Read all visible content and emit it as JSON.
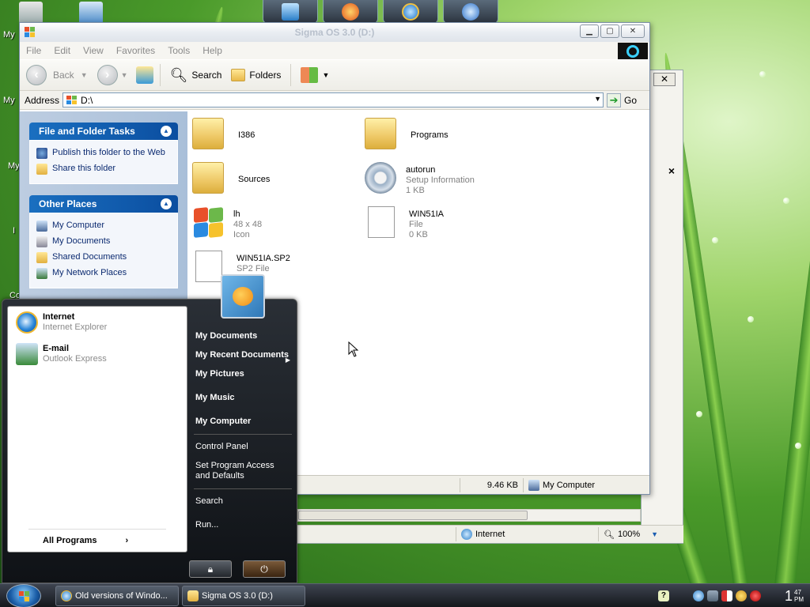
{
  "desktop": {
    "icon_labels": [
      "My",
      "My",
      "My",
      "I",
      "Co"
    ]
  },
  "explorer": {
    "title": "Sigma OS 3.0 (D:)",
    "menu": [
      "File",
      "Edit",
      "View",
      "Favorites",
      "Tools",
      "Help"
    ],
    "toolbar": {
      "back": "Back",
      "search": "Search",
      "folders": "Folders"
    },
    "address": {
      "label": "Address",
      "value": "D:\\",
      "go": "Go"
    },
    "tasks_panel": {
      "title": "File and Folder Tasks",
      "items": [
        "Publish this folder to the Web",
        "Share this folder"
      ]
    },
    "places_panel": {
      "title": "Other Places",
      "items": [
        "My Computer",
        "My Documents",
        "Shared Documents",
        "My Network Places"
      ]
    },
    "files": [
      {
        "name": "I386",
        "line2": "",
        "line3": "",
        "icon": "folder-icon"
      },
      {
        "name": "Programs",
        "line2": "",
        "line3": "",
        "icon": "folder-icon"
      },
      {
        "name": "Sources",
        "line2": "",
        "line3": "",
        "icon": "folder-icon"
      },
      {
        "name": "autorun",
        "line2": "Setup Information",
        "line3": "1 KB",
        "icon": "settings-file-icon"
      },
      {
        "name": "lh",
        "line2": "48 x 48",
        "line3": "Icon",
        "icon": "windows-logo-icon"
      },
      {
        "name": "WIN51IA",
        "line2": "File",
        "line3": "0 KB",
        "icon": "file-icon"
      },
      {
        "name": "WIN51IA.SP2",
        "line2": "SP2 File",
        "line3": "",
        "icon": "file-icon"
      }
    ],
    "status": {
      "size": "9.46 KB",
      "location": "My Computer"
    }
  },
  "ie_window": {
    "close": "✕",
    "status_zone": "Internet",
    "zoom": "100%"
  },
  "start_menu": {
    "pinned": [
      {
        "title": "Internet",
        "subtitle": "Internet Explorer"
      },
      {
        "title": "E-mail",
        "subtitle": "Outlook Express"
      }
    ],
    "all_programs": "All Programs",
    "right_items": [
      {
        "label": "My Documents",
        "bold": true
      },
      {
        "label": "My Recent Documents",
        "bold": true
      },
      {
        "label": "My Pictures",
        "bold": true
      },
      {
        "label": "My Music",
        "bold": true
      },
      {
        "label": "My Computer",
        "bold": true
      },
      {
        "label": "Control Panel",
        "bold": false
      },
      {
        "label": "Set Program Access and Defaults",
        "bold": false
      },
      {
        "label": "Search",
        "bold": false
      },
      {
        "label": "Run...",
        "bold": false
      }
    ]
  },
  "taskbar": {
    "tasks": [
      "Old versions of Windo...",
      "Sigma OS 3.0 (D:)"
    ],
    "clock_hour": "1",
    "clock_minute": "47",
    "clock_period": "PM",
    "tray_help": "?"
  },
  "colors": {
    "panel_header": "#1a6fc0",
    "pane_bg": "#b4c7de",
    "start_bg": "#1b1f24",
    "link": "#0b2a70"
  }
}
